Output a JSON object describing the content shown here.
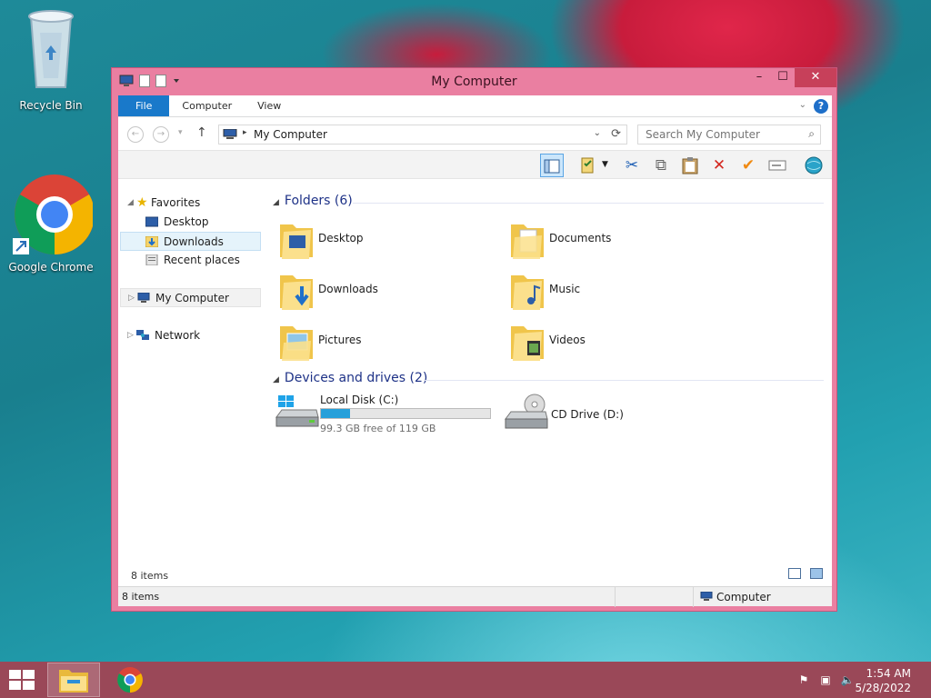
{
  "desktop": {
    "recycle_bin_label": "Recycle Bin",
    "chrome_label": "Google Chrome"
  },
  "window": {
    "title": "My Computer",
    "controls": {
      "minimize": "–",
      "maximize": "☐",
      "close": "✕"
    }
  },
  "ribbon": {
    "tabs": [
      "File",
      "Computer",
      "View"
    ],
    "help": "?"
  },
  "address": {
    "crumb": "My Computer",
    "search_placeholder": "Search My Computer"
  },
  "nav": {
    "favorites": "Favorites",
    "desktop": "Desktop",
    "downloads": "Downloads",
    "recent": "Recent places",
    "computer": "My Computer",
    "network": "Network"
  },
  "content": {
    "folders_header": "Folders (6)",
    "folders": [
      "Desktop",
      "Documents",
      "Downloads",
      "Music",
      "Pictures",
      "Videos"
    ],
    "drives_header": "Devices and drives (2)",
    "drives": [
      {
        "name": "Local Disk (C:)",
        "free": "99.3 GB free of 119 GB",
        "used_fraction": 0.17
      },
      {
        "name": "CD Drive (D:)"
      }
    ]
  },
  "status": {
    "items_count": "8 items",
    "bar_items": "8 items",
    "bar_location": "Computer"
  },
  "taskbar": {
    "time": "1:54 AM",
    "date": "5/28/2022"
  },
  "colors": {
    "window_frame": "#ea7fa1",
    "file_tab": "#1979ca",
    "taskbar": "#9a4858",
    "drive_fill": "#26a0da"
  }
}
